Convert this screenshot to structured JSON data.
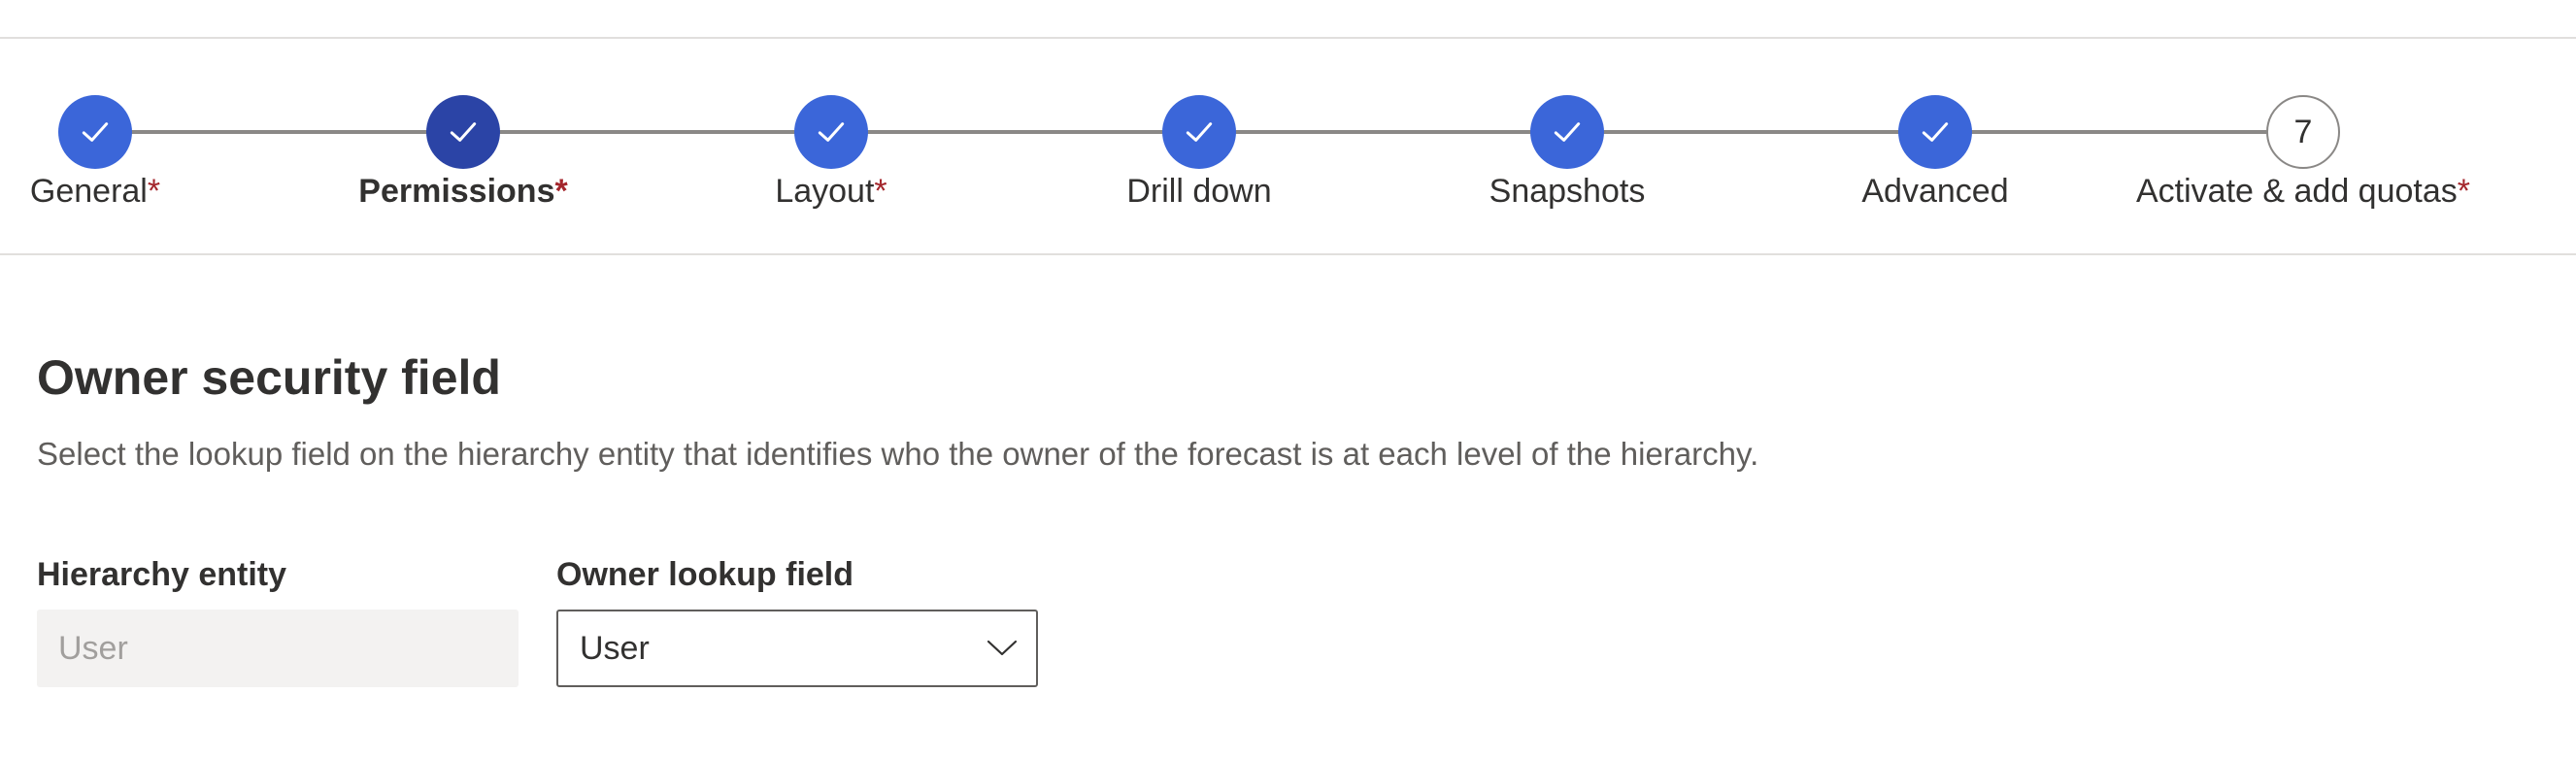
{
  "stepper": {
    "steps": [
      {
        "label": "General",
        "required": true,
        "state": "completed"
      },
      {
        "label": "Permissions",
        "required": true,
        "state": "current"
      },
      {
        "label": "Layout",
        "required": true,
        "state": "completed"
      },
      {
        "label": "Drill down",
        "required": false,
        "state": "completed"
      },
      {
        "label": "Snapshots",
        "required": false,
        "state": "completed"
      },
      {
        "label": "Advanced",
        "required": false,
        "state": "completed"
      },
      {
        "label": "Activate & add quotas",
        "required": true,
        "state": "pending",
        "number": "7"
      }
    ],
    "required_marker": "*"
  },
  "section": {
    "title": "Owner security field",
    "description": "Select the lookup field on the hierarchy entity that identifies who the owner of the forecast is at each level of the hierarchy."
  },
  "hierarchy_entity": {
    "label": "Hierarchy entity",
    "value": "User"
  },
  "owner_lookup": {
    "label": "Owner lookup field",
    "value": "User"
  },
  "colors": {
    "step_completed": "#3b66d9",
    "step_current": "#2b44a6",
    "required_marker": "#a4262c",
    "connector": "#8a8886"
  }
}
